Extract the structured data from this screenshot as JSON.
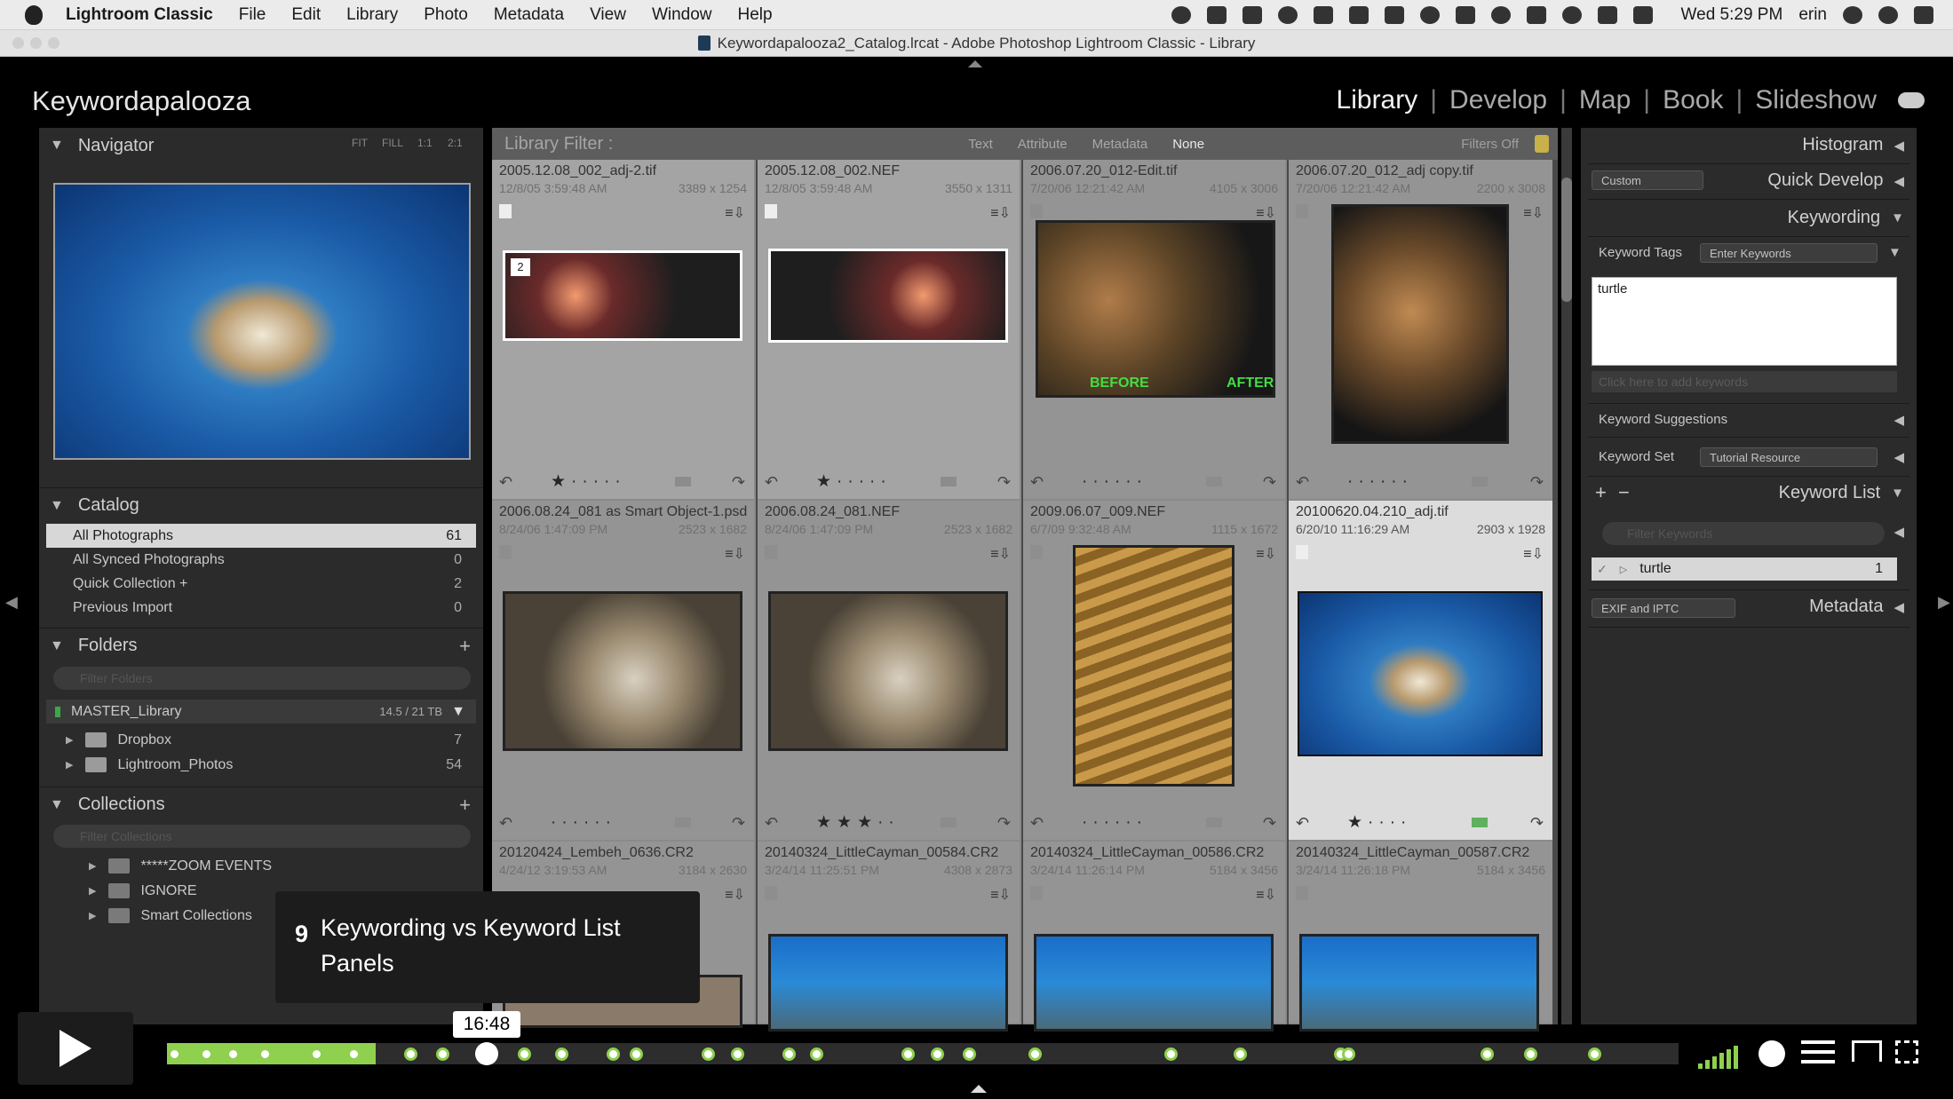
{
  "menubar": {
    "app_name": "Lightroom Classic",
    "items": [
      "File",
      "Edit",
      "Library",
      "Photo",
      "Metadata",
      "View",
      "Window",
      "Help"
    ],
    "clock": "Wed 5:29 PM",
    "user": "erin"
  },
  "window_title": "Keywordapalooza2_Catalog.lrcat - Adobe Photoshop Lightroom Classic - Library",
  "identity_plate": "Keywordapalooza",
  "modules": [
    {
      "label": "Library",
      "active": true
    },
    {
      "label": "Develop"
    },
    {
      "label": "Map"
    },
    {
      "label": "Book"
    },
    {
      "label": "Slideshow"
    }
  ],
  "navigator": {
    "title": "Navigator",
    "zoom_fit": "FIT",
    "zoom_fill": "FILL",
    "zoom_1": "1:1",
    "zoom_2": "2:1"
  },
  "catalog": {
    "title": "Catalog",
    "items": [
      {
        "label": "All Photographs",
        "count": "61",
        "selected": true
      },
      {
        "label": "All Synced Photographs",
        "count": "0"
      },
      {
        "label": "Quick Collection +",
        "count": "2"
      },
      {
        "label": "Previous Import",
        "count": "0"
      }
    ]
  },
  "folders": {
    "title": "Folders",
    "filter_placeholder": "Filter Folders",
    "volume": {
      "label": "MASTER_Library",
      "size": "14.5 / 21 TB"
    },
    "items": [
      {
        "label": "Dropbox",
        "count": "7"
      },
      {
        "label": "Lightroom_Photos",
        "count": "54"
      }
    ]
  },
  "collections": {
    "title": "Collections",
    "filter_placeholder": "Filter Collections",
    "items": [
      {
        "label": "*****ZOOM EVENTS"
      },
      {
        "label": "IGNORE"
      },
      {
        "label": "Smart Collections"
      }
    ]
  },
  "library_filter": {
    "label": "Library Filter :",
    "tabs": [
      "Text",
      "Attribute",
      "Metadata",
      "None"
    ],
    "status": "Filters Off"
  },
  "grid": [
    {
      "filename": "2005.12.08_002_adj-2.tif",
      "date": "12/8/05 3:59:48 AM",
      "dims": "3389 x 1254",
      "rating": 1,
      "stack": "2"
    },
    {
      "filename": "2005.12.08_002.NEF",
      "date": "12/8/05 3:59:48 AM",
      "dims": "3550 x 1311",
      "rating": 1
    },
    {
      "filename": "2006.07.20_012-Edit.tif",
      "date": "7/20/06 12:21:42 AM",
      "dims": "4105 x 3006",
      "rating": 0,
      "before_label": "BEFORE",
      "after_label": "AFTER"
    },
    {
      "filename": "2006.07.20_012_adj copy.tif",
      "date": "7/20/06 12:21:42 AM",
      "dims": "2200 x 3008",
      "rating": 0
    },
    {
      "filename": "2006.08.24_081 as Smart Object-1.psd",
      "date": "8/24/06 1:47:09 PM",
      "dims": "2523 x 1682",
      "rating": 0
    },
    {
      "filename": "2006.08.24_081.NEF",
      "date": "8/24/06 1:47:09 PM",
      "dims": "2523 x 1682",
      "rating": 3
    },
    {
      "filename": "2009.06.07_009.NEF",
      "date": "6/7/09 9:32:48 AM",
      "dims": "1115 x 1672",
      "rating": 0
    },
    {
      "filename": "20100620.04.210_adj.tif",
      "date": "6/20/10 11:16:29 AM",
      "dims": "2903 x 1928",
      "rating": 1,
      "selected": true
    },
    {
      "filename": "20120424_Lembeh_0636.CR2",
      "date": "4/24/12 3:19:53 AM",
      "dims": "3184 x 2630"
    },
    {
      "filename": "20140324_LittleCayman_00584.CR2",
      "date": "3/24/14 11:25:51 PM",
      "dims": "4308 x 2873"
    },
    {
      "filename": "20140324_LittleCayman_00586.CR2",
      "date": "3/24/14 11:26:14 PM",
      "dims": "5184 x 3456"
    },
    {
      "filename": "20140324_LittleCayman_00587.CR2",
      "date": "3/24/14 11:26:18 PM",
      "dims": "5184 x 3456"
    }
  ],
  "right_panel": {
    "histogram": "Histogram",
    "quick_develop": "Quick Develop",
    "quick_develop_preset": "Custom",
    "keywording": "Keywording",
    "keyword_tags_label": "Keyword Tags",
    "keyword_tags_mode": "Enter Keywords",
    "keyword_text": "turtle",
    "add_keywords_placeholder": "Click here to add keywords",
    "keyword_suggestions": "Keyword Suggestions",
    "keyword_set_label": "Keyword Set",
    "keyword_set_value": "Tutorial Resource",
    "keyword_list": "Keyword List",
    "keyword_filter_placeholder": "Filter Keywords",
    "keyword_entry": {
      "label": "turtle",
      "count": "1"
    },
    "metadata": "Metadata",
    "metadata_preset": "EXIF and IPTC"
  },
  "player": {
    "chapter_number": "9",
    "chapter_title": "Keywording vs Keyword List Panels",
    "current_time": "16:48",
    "progress": 0.136
  },
  "colors": {
    "accent": "#8fd04f",
    "panel": "#2b2b2b",
    "grid_bg": "#a4a4a4"
  }
}
